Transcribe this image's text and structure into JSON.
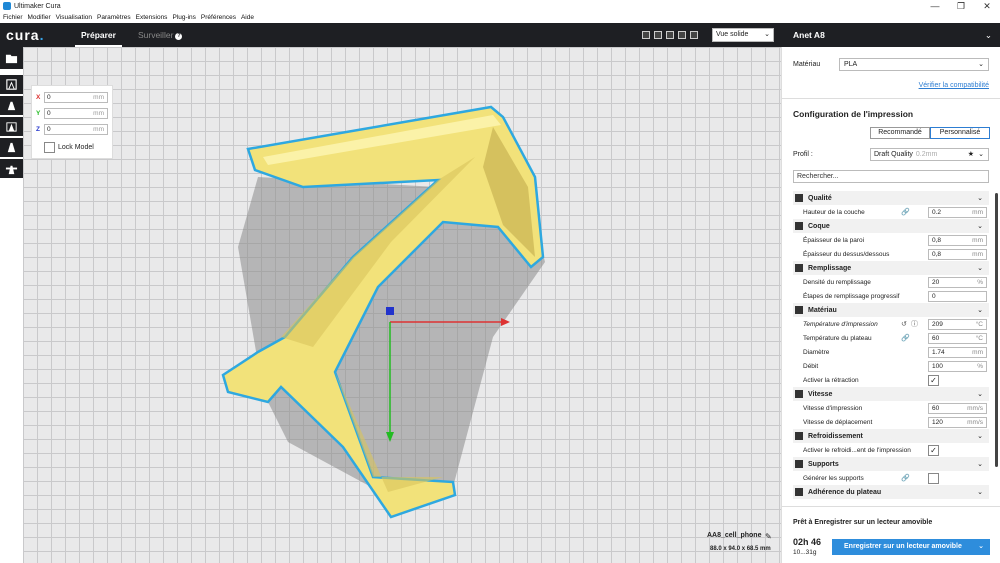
{
  "window": {
    "title": "Ultimaker Cura",
    "controls": [
      "—",
      "❐",
      "✕"
    ]
  },
  "menu": [
    "Fichier",
    "Modifier",
    "Visualisation",
    "Paramètres",
    "Extensions",
    "Plug-ins",
    "Préférences",
    "Aide"
  ],
  "header": {
    "logo": "cura",
    "tabs": {
      "prepare": "Préparer",
      "monitor": "Surveiller"
    },
    "view_mode": "Vue solide"
  },
  "printer": {
    "name": "Anet A8"
  },
  "move_panel": {
    "x": {
      "axis": "X",
      "value": "0",
      "unit": "mm"
    },
    "y": {
      "axis": "Y",
      "value": "0",
      "unit": "mm"
    },
    "z": {
      "axis": "Z",
      "value": "0",
      "unit": "mm"
    },
    "lock_label": "Lock Model"
  },
  "object": {
    "name": "AA8_cell_phone",
    "dims": "88.0 x 94.0 x 68.5 mm"
  },
  "material": {
    "label": "Matériau",
    "value": "PLA",
    "compat_link": "Vérifier la compatibilité"
  },
  "config": {
    "title": "Configuration de l'impression",
    "mode_recommended": "Recommandé",
    "mode_custom": "Personnalisé",
    "profile_label": "Profil :",
    "profile_value": "Draft Quality",
    "profile_sub": "0.2mm",
    "search_placeholder": "Rechercher..."
  },
  "settings": {
    "quality": {
      "label": "Qualité",
      "layer_height": {
        "label": "Hauteur de la couche",
        "value": "0.2",
        "unit": "mm"
      }
    },
    "shell": {
      "label": "Coque",
      "wall": {
        "label": "Épaisseur de la paroi",
        "value": "0,8",
        "unit": "mm"
      },
      "topbottom": {
        "label": "Épaisseur du dessus/dessous",
        "value": "0,8",
        "unit": "mm"
      }
    },
    "infill": {
      "label": "Remplissage",
      "density": {
        "label": "Densité du remplissage",
        "value": "20",
        "unit": "%"
      },
      "steps": {
        "label": "Étapes de remplissage progressif",
        "value": "0"
      }
    },
    "material": {
      "label": "Matériau",
      "print_temp": {
        "label": "Température d'impression",
        "value": "209",
        "unit": "°C"
      },
      "bed_temp": {
        "label": "Température du plateau",
        "value": "60",
        "unit": "°C"
      },
      "diameter": {
        "label": "Diamètre",
        "value": "1.74",
        "unit": "mm"
      },
      "flow": {
        "label": "Débit",
        "value": "100",
        "unit": "%"
      },
      "retraction": {
        "label": "Activer la rétraction",
        "check": "✓"
      }
    },
    "speed": {
      "label": "Vitesse",
      "print_speed": {
        "label": "Vitesse d'impression",
        "value": "60",
        "unit": "mm/s"
      },
      "travel_speed": {
        "label": "Vitesse de déplacement",
        "value": "120",
        "unit": "mm/s"
      }
    },
    "cooling": {
      "label": "Refroidissement",
      "fan": {
        "label": "Activer le refroidi...ent de l'impression",
        "check": "✓"
      }
    },
    "support": {
      "label": "Supports",
      "generate": {
        "label": "Générer les supports"
      }
    },
    "adhesion": {
      "label": "Adhérence du plateau"
    }
  },
  "save": {
    "status": "Prêt à Enregistrer sur un lecteur amovible",
    "time": "02h 46",
    "size": "10...31g",
    "button": "Enregistrer sur un lecteur amovible"
  },
  "colors": {
    "dark": "#1e1f23",
    "accent": "#2e8ddc",
    "model": "#f2e27a",
    "outline": "#2ea8e0"
  }
}
